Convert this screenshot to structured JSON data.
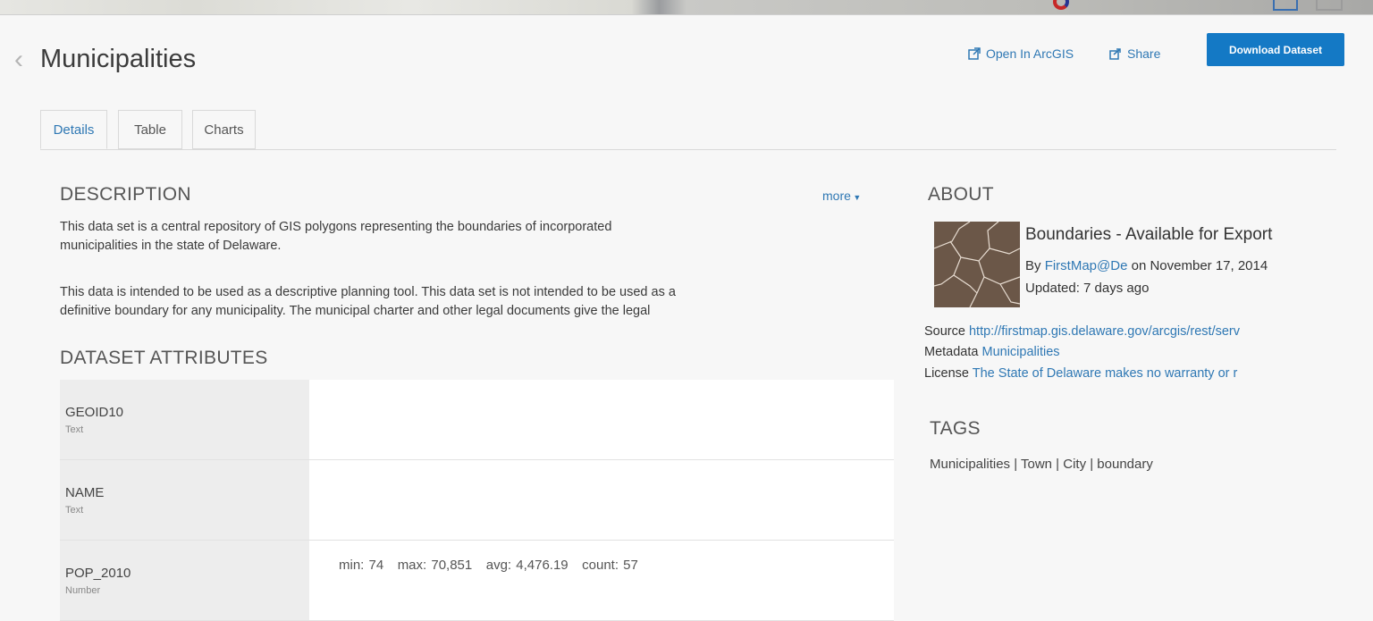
{
  "header": {
    "title": "Municipalities",
    "open_label": "Open In ArcGIS",
    "share_label": "Share",
    "download_label": "Download Dataset"
  },
  "tabs": [
    {
      "label": "Details",
      "active": true
    },
    {
      "label": "Table",
      "active": false
    },
    {
      "label": "Charts",
      "active": false
    }
  ],
  "description": {
    "heading": "DESCRIPTION",
    "more_label": "more",
    "para1_line1": "This data set is a central repository of GIS polygons representing the boundaries of incorporated",
    "para1_line2": "municipalities in the state of Delaware.",
    "para2_line1": "This data is intended to be used as a descriptive planning tool. This data set is not intended to be used as a",
    "para2_line2": "definitive boundary for any municipality. The municipal charter and other legal documents give the legal"
  },
  "attributes": {
    "heading": "DATASET ATTRIBUTES",
    "rows": [
      {
        "name": "GEOID10",
        "type": "Text",
        "stats": ""
      },
      {
        "name": "NAME",
        "type": "Text",
        "stats": ""
      },
      {
        "name": "POP_2010",
        "type": "Number",
        "stats": "min: 74   max: 70,851   avg: 4,476.19   count: 57"
      }
    ]
  },
  "about": {
    "heading": "ABOUT",
    "title": "Boundaries - Available for Export",
    "by_prefix": "By",
    "author": "FirstMap@De",
    "date_text": "on November 17, 2014",
    "updated": "Updated: 7 days ago",
    "source_label": "Source",
    "source_url": "http://firstmap.gis.delaware.gov/arcgis/rest/serv",
    "metadata_label": "Metadata",
    "metadata_value": "Municipalities",
    "license_label": "License",
    "license_value": "The State of Delaware makes no warranty or r"
  },
  "tags": {
    "heading": "TAGS",
    "text": "Municipalities | Town | City | boundary"
  },
  "colors": {
    "accent": "#1479c5",
    "link": "#2f78b4",
    "thumbnail": "#6b5748"
  }
}
